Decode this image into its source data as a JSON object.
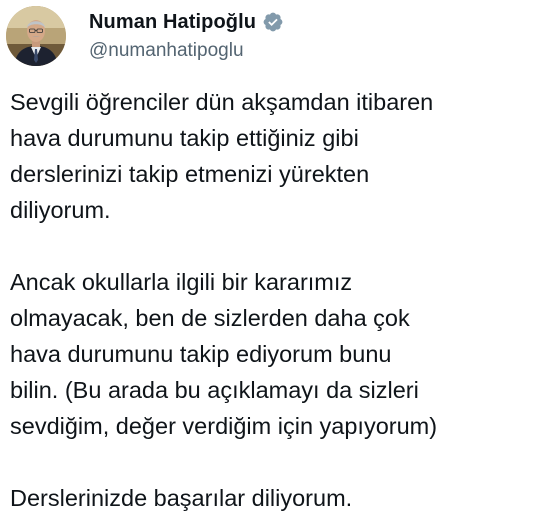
{
  "tweet": {
    "author": {
      "display_name": "Numan Hatipoğlu",
      "handle": "@numanhatipoglu",
      "verified_icon": "verified-badge-icon",
      "verified_color": "#829aab"
    },
    "paragraphs": [
      "Sevgili öğrenciler dün akşamdan itibaren\nhava durumunu takip ettiğiniz gibi\nderslerinizi takip etmenizi yürekten\ndiliyorum.",
      "Ancak okullarla ilgili bir kararımız\nolmayacak, ben de sizlerden daha çok\nhava durumunu takip ediyorum bunu\nbilin. (Bu arada bu açıklamayı da sizleri\nsevdiğim, değer verdiğim için yapıyorum)",
      "Derslerinizde başarılar diliyorum."
    ]
  }
}
